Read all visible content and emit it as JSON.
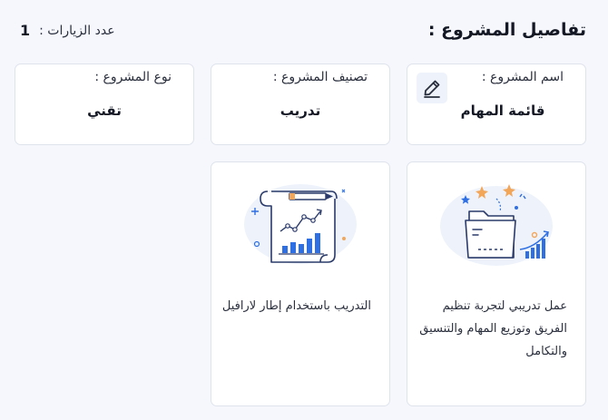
{
  "header": {
    "title": "تفاصيل المشروع :",
    "visits_label": "عدد الزيارات :",
    "visits_value": "1"
  },
  "info_cards": {
    "name": {
      "label": "اسم المشروع :",
      "value": "قائمة المهام",
      "icon": "pencil-icon"
    },
    "category": {
      "label": "تصنيف المشروع :",
      "value": "تدريب"
    },
    "type": {
      "label": "نوع المشروع :",
      "value": "تقني"
    }
  },
  "media_cards": [
    {
      "illustration": "folder-growth-chart-illustration",
      "description": "عمل تدريبي لتجربة تنظيم الفريق وتوزيع المهام والتنسيق والتكامل"
    },
    {
      "illustration": "document-chart-illustration",
      "description": "التدريب باستخدام إطار لارافيل"
    }
  ],
  "colors": {
    "background": "#f5f7fc",
    "card_border": "#dfe3ec",
    "accent_blue": "#2f6fe4",
    "accent_orange": "#f2a65a"
  }
}
